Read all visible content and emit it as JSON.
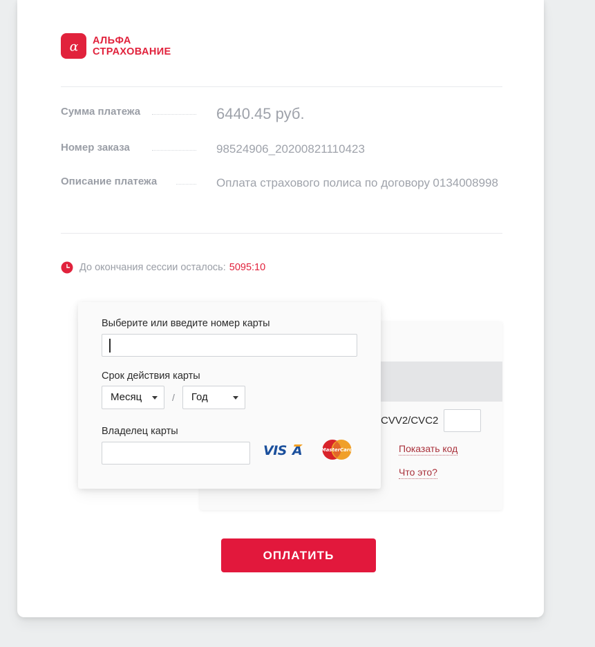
{
  "brand": {
    "logo_icon": "alfa-alpha-logo-icon",
    "name_line1": "АЛЬФА",
    "name_line2": "СТРАХОВАНИЕ",
    "brand_color": "#e1223c"
  },
  "details": {
    "rows": [
      {
        "label": "Сумма платежа",
        "value": "6440.45 руб.",
        "value2": ""
      },
      {
        "label": "Номер заказа",
        "value": "98524906_20200821110423",
        "value2": ""
      },
      {
        "label": "Описание платежа",
        "value": "Оплата страхового полиса по договору",
        "value2": "0134008998"
      }
    ]
  },
  "session": {
    "clock_icon": "clock-icon",
    "text": "До окончания сессии осталось:",
    "value": "5095:10",
    "value_color": "#e1223c"
  },
  "card_form": {
    "card_number_label": "Выберите или введите номер карты",
    "card_number_value": "",
    "expiry_label": "Срок действия карты",
    "month_placeholder": "Месяц",
    "year_placeholder": "Год",
    "expiry_separator": "/",
    "holder_label": "Владелец карты",
    "holder_value": "",
    "brand_logos": [
      "visa-logo-icon",
      "mastercard-logo-icon"
    ]
  },
  "cvv_panel": {
    "label": "CVV2/CVC2",
    "value": "",
    "show_code_link": "Показать код",
    "what_is_this_link": "Что это?",
    "link_color": "#a9303a"
  },
  "actions": {
    "pay_label": "ОПЛАТИТЬ",
    "pay_color": "#e2183c"
  }
}
